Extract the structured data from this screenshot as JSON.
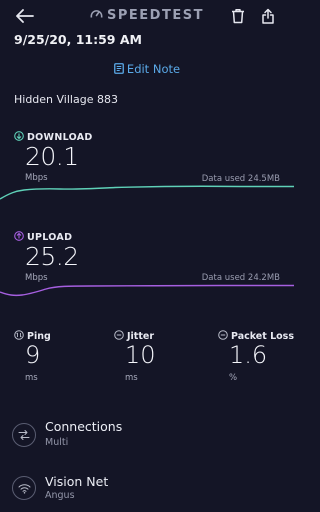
{
  "header": {
    "title": "SPEEDTEST"
  },
  "result": {
    "timestamp": "9/25/20, 11:59 AM",
    "edit_note": "Edit Note",
    "server_name": "Hidden Village 883"
  },
  "download": {
    "label": "DOWNLOAD",
    "value": "20.1",
    "unit": "Mbps",
    "data_used": "Data used 24.5MB",
    "color": "#5fd1b8"
  },
  "upload": {
    "label": "UPLOAD",
    "value": "25.2",
    "unit": "Mbps",
    "data_used": "Data used 24.2MB",
    "color": "#a65fe0"
  },
  "stats": {
    "ping": {
      "label": "Ping",
      "value": "9",
      "unit": "ms"
    },
    "jitter": {
      "label": "Jitter",
      "value": "10",
      "unit": "ms"
    },
    "packet_loss": {
      "label": "Packet Loss",
      "value": "1.6",
      "unit": "%"
    }
  },
  "connections": {
    "title": "Connections",
    "subtitle": "Multi"
  },
  "provider": {
    "title": "Vision Net",
    "subtitle": "Angus"
  }
}
